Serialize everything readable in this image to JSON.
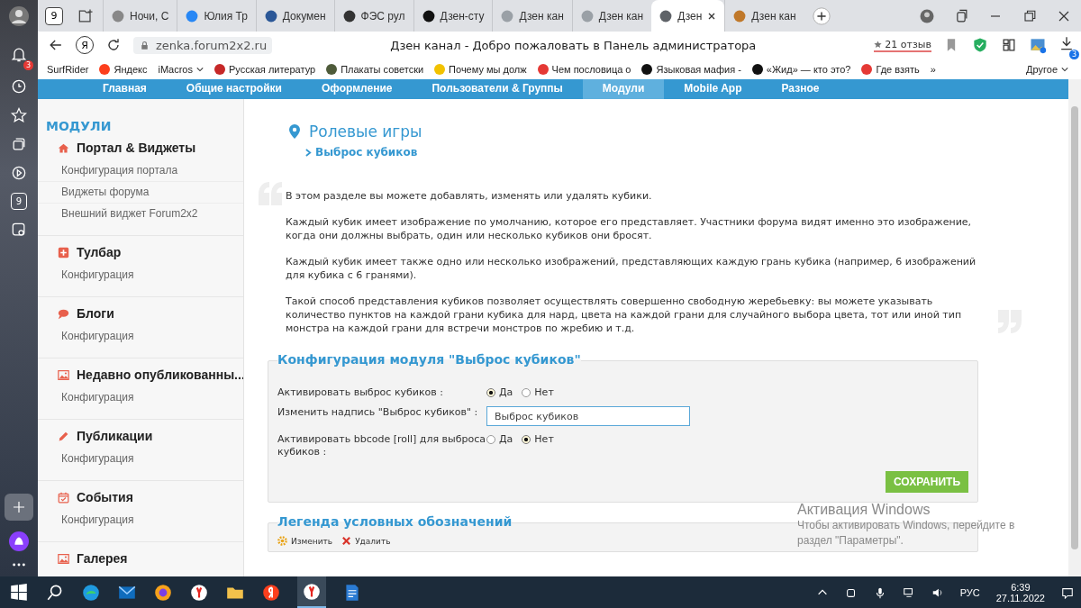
{
  "browser": {
    "tab_count": "9",
    "tabs": [
      {
        "title": "Ночи, С",
        "selected": false,
        "color": "#888888"
      },
      {
        "title": "Юлия Тр",
        "selected": false,
        "color": "#2787f5"
      },
      {
        "title": "Докумен",
        "selected": false,
        "color": "#2b5797"
      },
      {
        "title": "ФЭС рул",
        "selected": false,
        "color": "#333333"
      },
      {
        "title": "Дзен-сту",
        "selected": false,
        "color": "#111111"
      },
      {
        "title": "Дзен кан",
        "selected": false,
        "color": "#9aa0a6"
      },
      {
        "title": "Дзен кан",
        "selected": false,
        "color": "#9aa0a6"
      },
      {
        "title": "Дзен",
        "selected": true,
        "color": "#5f6368"
      },
      {
        "title": "Дзен кан",
        "selected": false,
        "color": "#c0782a"
      }
    ],
    "notifications_badge": "3",
    "sidebar_count": "9",
    "logo_letter": "Я",
    "url": "zenka.forum2x2.ru",
    "page_title": "Дзен канал - Добро пожаловать в Панель администратора",
    "reviews": "21 отзыв",
    "downloads_badge": "3",
    "bookmarks": [
      {
        "label": "SurfRider"
      },
      {
        "label": "Яндекс",
        "color": "#fc3f1d"
      },
      {
        "label": "iMacros",
        "menu": true
      },
      {
        "label": "Русская литератур",
        "color": "#c62828"
      },
      {
        "label": "Плакаты советски",
        "color": "#4e5b3a"
      },
      {
        "label": "Почему мы долж",
        "color": "#f2c200"
      },
      {
        "label": "Чем пословица о",
        "color": "#e53935"
      },
      {
        "label": "Языковая мафия -",
        "color": "#111111"
      },
      {
        "label": "«Жид» — кто это?",
        "color": "#111111"
      },
      {
        "label": "Где взять",
        "color": "#e53935"
      }
    ],
    "more": "»",
    "other": "Другое"
  },
  "nav": [
    {
      "label": "Главная",
      "selected": false
    },
    {
      "label": "Общие настройки",
      "selected": false
    },
    {
      "label": "Оформление",
      "selected": false
    },
    {
      "label": "Пользователи & Группы",
      "selected": false
    },
    {
      "label": "Модули",
      "selected": true
    },
    {
      "label": "Mobile App",
      "selected": false
    },
    {
      "label": "Разное",
      "selected": false
    }
  ],
  "sidebar": {
    "heading": "МОДУЛИ",
    "sections": [
      {
        "title": "Портал & Виджеты",
        "items": [
          "Конфигурация портала",
          "Виджеты форума",
          "Внешний виджет Forum2x2"
        ]
      },
      {
        "title": "Тулбар",
        "items": [
          "Конфигурация"
        ]
      },
      {
        "title": "Блоги",
        "items": [
          "Конфигурация"
        ]
      },
      {
        "title": "Недавно опубликованны...",
        "items": [
          "Конфигурация"
        ]
      },
      {
        "title": "Публикации",
        "items": [
          "Конфигурация"
        ]
      },
      {
        "title": "События",
        "items": [
          "Конфигурация"
        ]
      },
      {
        "title": "Галерея"
      }
    ]
  },
  "content": {
    "title": "Ролевые игры",
    "subtitle": "Выброс кубиков",
    "paragraphs": [
      "В этом разделе вы можете добавлять, изменять или удалять кубики.",
      "Каждый кубик имеет изображение по умолчанию, которое его представляет. Участники форума видят именно это изображение, когда они должны выбрать, один или несколько кубиков они бросят.",
      "Каждый кубик имеет также одно или несколько изображений, представляющих каждую грань кубика (например, 6 изображений для кубика с 6 гранями).",
      "Такой способ представления кубиков позволяет осуществлять совершенно свободную жеребьевку: вы можете указывать количество пунктов на каждой грани кубика для нард, цвета на каждой грани для случайного выбора цвета, тот или иной тип монстра на каждой грани для встречи монстров по жребию и т.д."
    ],
    "config": {
      "title": "Конфигурация модуля \"Выброс кубиков\"",
      "rows": [
        {
          "kind": "radio",
          "label": "Активировать выброс кубиков :",
          "options": [
            {
              "label": "Да",
              "selected": true
            },
            {
              "label": "Нет",
              "selected": false
            }
          ]
        },
        {
          "kind": "text",
          "label": "Изменить надпись \"Выброс кубиков\" :",
          "value": "Выброс кубиков"
        },
        {
          "kind": "radio",
          "label": "Активировать bbcode [roll] для выброса кубиков :",
          "options": [
            {
              "label": "Да",
              "selected": false
            },
            {
              "label": "Нет",
              "selected": true
            }
          ]
        }
      ],
      "save": "СОХРАНИТЬ"
    },
    "legend": {
      "title": "Легенда условных обозначений",
      "items": [
        {
          "kind": "edit",
          "label": "Изменить"
        },
        {
          "kind": "delete",
          "label": "Удалить"
        }
      ]
    }
  },
  "activation": {
    "title": "Активация Windows",
    "text": "Чтобы активировать Windows, перейдите в раздел \"Параметры\"."
  },
  "taskbar": {
    "language": "РУС",
    "time": "6:39",
    "date": "27.11.2022"
  }
}
